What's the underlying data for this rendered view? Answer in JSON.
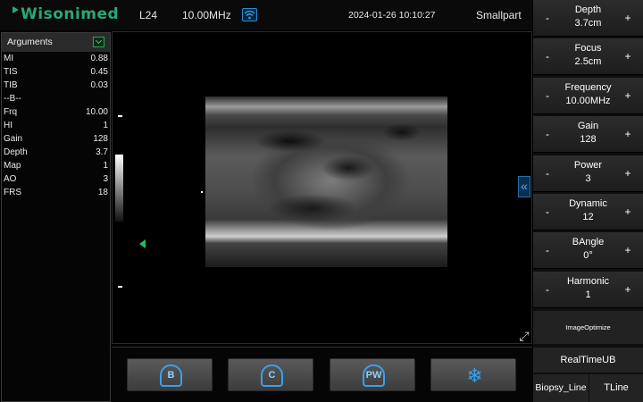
{
  "header": {
    "logo": "Wisonimed",
    "probe": "L24",
    "frequency": "10.00MHz",
    "datetime": "2024-01-26 10:10:27",
    "preset": "Smallpart"
  },
  "arguments": {
    "title": "Arguments",
    "rows": [
      {
        "k": "MI",
        "v": "0.88"
      },
      {
        "k": "TIS",
        "v": "0.45"
      },
      {
        "k": "TIB",
        "v": "0.03"
      },
      {
        "k": "--B--",
        "v": ""
      },
      {
        "k": "Frq",
        "v": "10.00"
      },
      {
        "k": "HI",
        "v": "1"
      },
      {
        "k": "Gain",
        "v": "128"
      },
      {
        "k": "Depth",
        "v": "3.7"
      },
      {
        "k": "Map",
        "v": "1"
      },
      {
        "k": "AO",
        "v": "3"
      },
      {
        "k": "FRS",
        "v": "18"
      }
    ]
  },
  "modes": [
    {
      "label": "B",
      "icon": "b-mode-icon"
    },
    {
      "label": "C",
      "icon": "c-mode-icon"
    },
    {
      "label": "PW",
      "icon": "pw-mode-icon"
    },
    {
      "label": "",
      "icon": "freeze-snowflake-icon"
    }
  ],
  "controls": [
    {
      "name": "Depth",
      "value": "3.7cm"
    },
    {
      "name": "Focus",
      "value": "2.5cm"
    },
    {
      "name": "Frequency",
      "value": "10.00MHz"
    },
    {
      "name": "Gain",
      "value": "128"
    },
    {
      "name": "Power",
      "value": "3"
    },
    {
      "name": "Dynamic",
      "value": "12"
    },
    {
      "name": "BAngle",
      "value": "0°"
    },
    {
      "name": "Harmonic",
      "value": "1"
    }
  ],
  "buttons": {
    "minus": "-",
    "plus": "+",
    "image_optimize": "ImageOptimize",
    "realtime_ub": "RealTimeUB",
    "biopsy_line": "Biopsy_Line",
    "tline": "TLine"
  },
  "colors": {
    "accent_blue": "#3aa0f0",
    "logo_green": "#2aa877",
    "focus_green": "#22c05a"
  }
}
